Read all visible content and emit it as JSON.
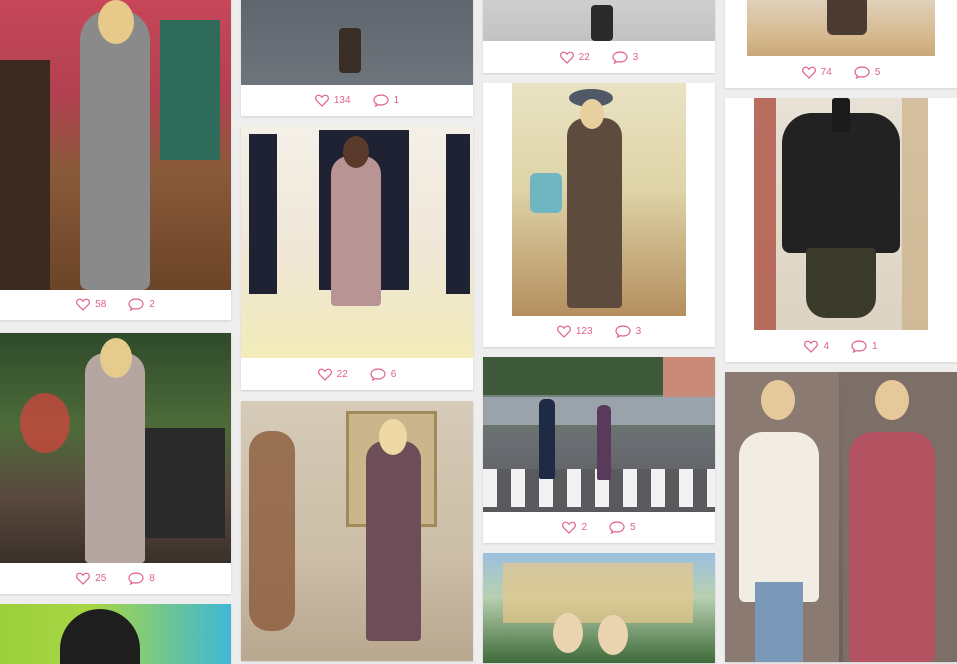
{
  "accent_color": "#e0608f",
  "icons": {
    "like": "heart-outline-icon",
    "comment": "speech-bubble-icon"
  },
  "columns": [
    [
      {
        "likes": "58",
        "comments": "2"
      },
      {
        "likes": "25",
        "comments": "8"
      },
      {
        "likes": "",
        "comments": ""
      }
    ],
    [
      {
        "likes": "134",
        "comments": "1"
      },
      {
        "likes": "22",
        "comments": "6"
      },
      {
        "likes": "",
        "comments": ""
      }
    ],
    [
      {
        "likes": "22",
        "comments": "3"
      },
      {
        "likes": "123",
        "comments": "3"
      },
      {
        "likes": "2",
        "comments": "5"
      },
      {
        "likes": "",
        "comments": ""
      }
    ],
    [
      {
        "likes": "74",
        "comments": "5"
      },
      {
        "likes": "4",
        "comments": "1"
      },
      {
        "likes": "",
        "comments": ""
      }
    ]
  ]
}
